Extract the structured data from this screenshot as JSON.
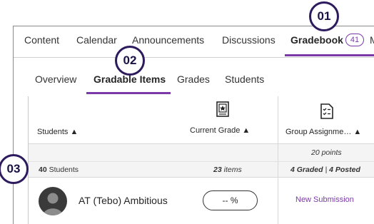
{
  "top_nav": {
    "tabs": [
      {
        "label": "Content"
      },
      {
        "label": "Calendar"
      },
      {
        "label": "Announcements"
      },
      {
        "label": "Discussions"
      },
      {
        "label": "Gradebook"
      }
    ],
    "gradebook_badge": "41",
    "overflow_text": "M"
  },
  "sub_nav": {
    "tabs": [
      {
        "label": "Overview"
      },
      {
        "label": "Gradable Items"
      },
      {
        "label": "Grades"
      },
      {
        "label": "Students"
      }
    ]
  },
  "grid": {
    "columns": {
      "students": "Students",
      "current_grade": "Current Grade",
      "group_assignment": "Group Assignme…"
    },
    "sort_icon": "sort-updown-icon",
    "points": "20 points",
    "summary": {
      "students_count": "40",
      "students_label": "Students",
      "items_count": "23",
      "items_label": "items",
      "graded": "4 Graded",
      "separator": "|",
      "posted": "4 Posted"
    },
    "row": {
      "name": "AT (Tebo) Ambitious",
      "grade": "-- %",
      "submission": "New Submission"
    }
  },
  "markers": [
    "01",
    "02",
    "03"
  ],
  "colors": {
    "accent": "#7c3aa8",
    "marker_border": "#2d1b5e"
  }
}
